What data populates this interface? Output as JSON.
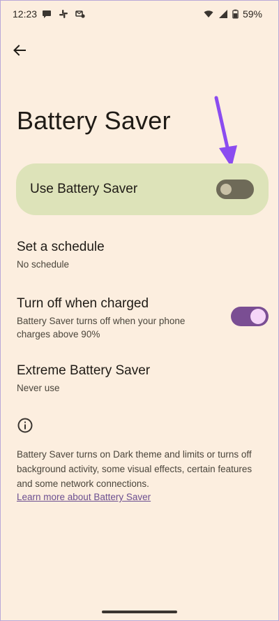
{
  "status_bar": {
    "time": "12:23",
    "battery_percent": "59%",
    "left_icons": [
      "chat-bubble-icon",
      "slack-icon",
      "messenger-icon"
    ],
    "right_icons": [
      "wifi-icon",
      "signal-icon",
      "battery-icon"
    ]
  },
  "header": {
    "back_icon": "arrow-left-icon"
  },
  "page": {
    "title": "Battery Saver"
  },
  "main_switch": {
    "label": "Use Battery Saver",
    "enabled": false
  },
  "settings": [
    {
      "title": "Set a schedule",
      "summary": "No schedule"
    },
    {
      "title": "Turn off when charged",
      "summary": "Battery Saver turns off when your phone charges above 90%",
      "enabled": true
    },
    {
      "title": "Extreme Battery Saver",
      "summary": "Never use"
    }
  ],
  "footer": {
    "info_icon": "info-icon",
    "description": "Battery Saver turns on Dark theme and limits or turns off background activity, some visual effects, certain features and some network connections.",
    "link": "Learn more about Battery Saver"
  },
  "colors": {
    "background": "#FCEEDF",
    "card": "#DDE3B9",
    "toggle_on": "#7A4E93",
    "arrow": "#8B4CF0",
    "link": "#6B4E90"
  }
}
